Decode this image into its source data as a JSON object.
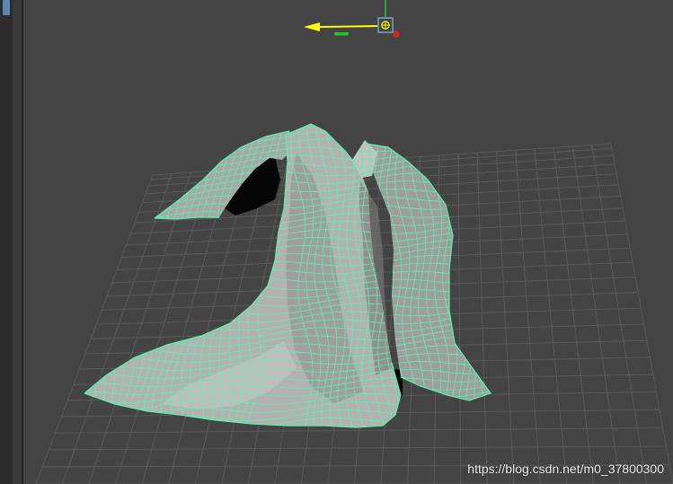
{
  "watermark": "https://blog.csdn.net/m0_37800300",
  "colors": {
    "background": "#444444",
    "grid": "#595959",
    "wire": "#5cf0b0",
    "cloth_light": "#bdbdbd",
    "cloth_mid": "#9a9a9a",
    "cloth_dark": "#767676",
    "manip_yellow": "#ffff00",
    "manip_green": "#2bc42b",
    "manip_red": "#e81e1e",
    "manip_blue": "#7aa3c8",
    "left_accent": "#5d88b4"
  },
  "icons": {
    "scene": "cloth-mesh-icon",
    "manipulator": "move-manipulator-icon"
  }
}
